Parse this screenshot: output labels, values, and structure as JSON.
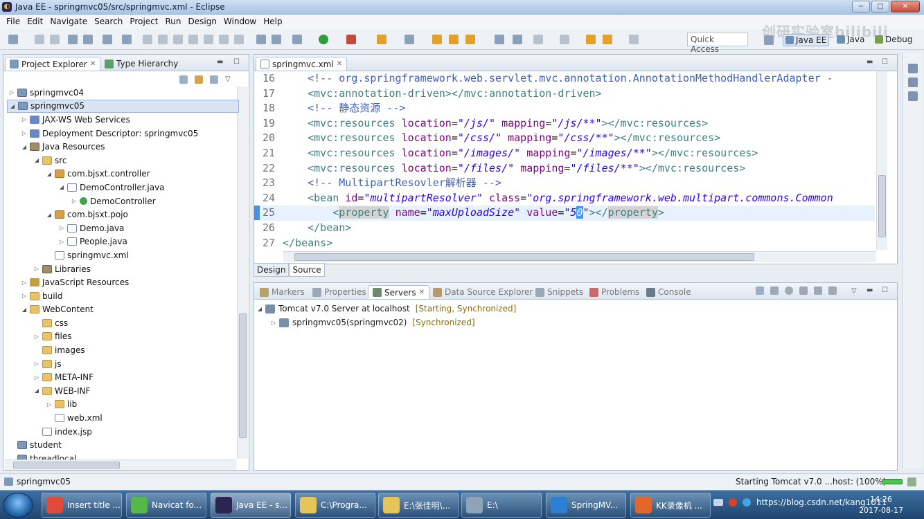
{
  "window": {
    "title": "Java EE - springmvc05/src/springmvc.xml - Eclipse",
    "buttons": [
      "−",
      "□",
      "✕"
    ]
  },
  "menu": [
    "File",
    "Edit",
    "Navigate",
    "Search",
    "Project",
    "Run",
    "Design",
    "Window",
    "Help"
  ],
  "toolbar": {
    "quick_access": "Quick Access",
    "perspectives": [
      "Java EE",
      "Java",
      "Debug"
    ]
  },
  "watermark": "创研实验室bilibili",
  "explorer": {
    "tabs": [
      {
        "label": "Project Explorer",
        "active": true
      },
      {
        "label": "Type Hierarchy",
        "active": false
      }
    ],
    "tree": [
      {
        "label": "springmvc04",
        "indent": 0,
        "arrow": "▷",
        "icon": "proj"
      },
      {
        "label": "springmvc05",
        "indent": 0,
        "arrow": "◢",
        "icon": "proj",
        "selected": true
      },
      {
        "label": "JAX-WS Web Services",
        "indent": 1,
        "arrow": "▷",
        "icon": "ws"
      },
      {
        "label": "Deployment Descriptor: springmvc05",
        "indent": 1,
        "arrow": "▷",
        "icon": "ws"
      },
      {
        "label": "Java Resources",
        "indent": 1,
        "arrow": "◢",
        "icon": "lib"
      },
      {
        "label": "src",
        "indent": 2,
        "arrow": "◢",
        "icon": "folder"
      },
      {
        "label": "com.bjsxt.controller",
        "indent": 3,
        "arrow": "◢",
        "icon": "pkg"
      },
      {
        "label": "DemoController.java",
        "indent": 4,
        "arrow": "◢",
        "icon": "java"
      },
      {
        "label": "DemoController",
        "indent": 5,
        "arrow": "▷",
        "icon": "cls"
      },
      {
        "label": "com.bjsxt.pojo",
        "indent": 3,
        "arrow": "◢",
        "icon": "pkg"
      },
      {
        "label": "Demo.java",
        "indent": 4,
        "arrow": "▷",
        "icon": "java"
      },
      {
        "label": "People.java",
        "indent": 4,
        "arrow": "▷",
        "icon": "java"
      },
      {
        "label": "springmvc.xml",
        "indent": 3,
        "arrow": "",
        "icon": "xml"
      },
      {
        "label": "Libraries",
        "indent": 2,
        "arrow": "▷",
        "icon": "lib"
      },
      {
        "label": "JavaScript Resources",
        "indent": 1,
        "arrow": "▷",
        "icon": "jsres"
      },
      {
        "label": "build",
        "indent": 1,
        "arrow": "▷",
        "icon": "folder"
      },
      {
        "label": "WebContent",
        "indent": 1,
        "arrow": "◢",
        "icon": "folder"
      },
      {
        "label": "css",
        "indent": 2,
        "arrow": "",
        "icon": "folder"
      },
      {
        "label": "files",
        "indent": 2,
        "arrow": "▷",
        "icon": "folder"
      },
      {
        "label": "images",
        "indent": 2,
        "arrow": "",
        "icon": "folder"
      },
      {
        "label": "js",
        "indent": 2,
        "arrow": "▷",
        "icon": "folder"
      },
      {
        "label": "META-INF",
        "indent": 2,
        "arrow": "▷",
        "icon": "folder"
      },
      {
        "label": "WEB-INF",
        "indent": 2,
        "arrow": "◢",
        "icon": "folder"
      },
      {
        "label": "lib",
        "indent": 3,
        "arrow": "▷",
        "icon": "folder"
      },
      {
        "label": "web.xml",
        "indent": 3,
        "arrow": "",
        "icon": "xml"
      },
      {
        "label": "index.jsp",
        "indent": 2,
        "arrow": "",
        "icon": "xml"
      },
      {
        "label": "student",
        "indent": 0,
        "arrow": "",
        "icon": "proj"
      },
      {
        "label": "threadlocal",
        "indent": 0,
        "arrow": "",
        "icon": "proj"
      }
    ]
  },
  "editor": {
    "tab": "springmvc.xml",
    "current_line": 25,
    "lines": [
      {
        "num": "16",
        "parts": [
          [
            "c-com",
            "    <!-- org.springframework.web.servlet.mvc.annotation.AnnotationMethodHandlerAdapter -"
          ]
        ]
      },
      {
        "num": "17",
        "parts": [
          [
            "c-tag",
            "    <mvc:annotation-driven></mvc:annotation-driven>"
          ]
        ]
      },
      {
        "num": "18",
        "parts": [
          [
            "c-com",
            "    <!-- 静态资源 -->"
          ]
        ]
      },
      {
        "num": "19",
        "parts": [
          [
            "c-tag",
            "    <mvc:resources "
          ],
          [
            "c-attr",
            "location"
          ],
          [
            "c-txt",
            "="
          ],
          [
            "c-val",
            "\"/js/\""
          ],
          [
            "c-txt",
            " "
          ],
          [
            "c-attr",
            "mapping"
          ],
          [
            "c-txt",
            "="
          ],
          [
            "c-val",
            "\"/js/**\""
          ],
          [
            "c-tag",
            "></mvc:resources>"
          ]
        ]
      },
      {
        "num": "20",
        "parts": [
          [
            "c-tag",
            "    <mvc:resources "
          ],
          [
            "c-attr",
            "location"
          ],
          [
            "c-txt",
            "="
          ],
          [
            "c-val",
            "\"/css/\""
          ],
          [
            "c-txt",
            " "
          ],
          [
            "c-attr",
            "mapping"
          ],
          [
            "c-txt",
            "="
          ],
          [
            "c-val",
            "\"/css/**\""
          ],
          [
            "c-tag",
            "></mvc:resources>"
          ]
        ]
      },
      {
        "num": "21",
        "parts": [
          [
            "c-tag",
            "    <mvc:resources "
          ],
          [
            "c-attr",
            "location"
          ],
          [
            "c-txt",
            "="
          ],
          [
            "c-val",
            "\"/images/\""
          ],
          [
            "c-txt",
            " "
          ],
          [
            "c-attr",
            "mapping"
          ],
          [
            "c-txt",
            "="
          ],
          [
            "c-val",
            "\"/images/**\""
          ],
          [
            "c-tag",
            "></mvc:resources>"
          ]
        ]
      },
      {
        "num": "22",
        "parts": [
          [
            "c-tag",
            "    <mvc:resources "
          ],
          [
            "c-attr",
            "location"
          ],
          [
            "c-txt",
            "="
          ],
          [
            "c-val",
            "\"/files/\""
          ],
          [
            "c-txt",
            " "
          ],
          [
            "c-attr",
            "mapping"
          ],
          [
            "c-txt",
            "="
          ],
          [
            "c-val",
            "\"/files/**\""
          ],
          [
            "c-tag",
            "></mvc:resources>"
          ]
        ]
      },
      {
        "num": "23",
        "parts": [
          [
            "c-com",
            "    <!-- MultipartResovler解析器 -->"
          ]
        ]
      },
      {
        "num": "24",
        "parts": [
          [
            "c-tag",
            "    <bean "
          ],
          [
            "c-attr",
            "id"
          ],
          [
            "c-txt",
            "="
          ],
          [
            "c-val",
            "\"multipartResolver\""
          ],
          [
            "c-txt",
            " "
          ],
          [
            "c-attr",
            "class"
          ],
          [
            "c-txt",
            "="
          ],
          [
            "c-val",
            "\"org.springframework.web.multipart.commons.Common"
          ]
        ]
      },
      {
        "num": "25",
        "parts": [
          [
            "c-tag",
            "        <"
          ],
          [
            "c-tag hl",
            "property"
          ],
          [
            "c-txt",
            " "
          ],
          [
            "c-attr",
            "name"
          ],
          [
            "c-txt",
            "="
          ],
          [
            "c-val",
            "\"maxUploadSize\""
          ],
          [
            "c-txt",
            " "
          ],
          [
            "c-attr",
            "value"
          ],
          [
            "c-txt",
            "="
          ],
          [
            "c-val",
            "\"5"
          ],
          [
            "c-val caret",
            "0"
          ],
          [
            "c-val",
            "\""
          ],
          [
            "c-tag",
            "></"
          ],
          [
            "c-tag hl",
            "property"
          ],
          [
            "c-tag",
            ">"
          ]
        ]
      },
      {
        "num": "26",
        "parts": [
          [
            "c-tag",
            "    </bean>"
          ]
        ]
      },
      {
        "num": "27",
        "parts": [
          [
            "c-tag",
            "</beans>"
          ]
        ]
      }
    ],
    "bottom_tabs": [
      "Design",
      "Source"
    ]
  },
  "console": {
    "tabs": [
      {
        "label": "Markers",
        "active": false
      },
      {
        "label": "Properties",
        "active": false
      },
      {
        "label": "Servers",
        "active": true
      },
      {
        "label": "Data Source Explorer",
        "active": false
      },
      {
        "label": "Snippets",
        "active": false
      },
      {
        "label": "Problems",
        "active": false
      },
      {
        "label": "Console",
        "active": false
      }
    ],
    "servers": [
      {
        "label": "Tomcat v7.0 Server at localhost",
        "status": "[Starting, Synchronized]",
        "arrow": "◢",
        "indent": 0
      },
      {
        "label": "springmvc05(springmvc02)",
        "status": "[Synchronized]",
        "arrow": "▷",
        "indent": 1
      }
    ]
  },
  "statusbar": {
    "left": "springmvc05",
    "right": "Starting Tomcat v7.0 ...host: (100%)",
    "progress": 1.0
  },
  "taskbar": {
    "items": [
      {
        "label": "Insert title ...",
        "color": "#e04a3a",
        "active": false
      },
      {
        "label": "Navicat fo...",
        "color": "#55b847",
        "active": false
      },
      {
        "label": "Java EE - s...",
        "color": "#2c2552",
        "active": true
      },
      {
        "label": "C:\\Progra...",
        "color": "#e5c45a",
        "active": false
      },
      {
        "label": "E:\\张佳明\\...",
        "color": "#e5c45a",
        "active": false
      },
      {
        "label": "E:\\",
        "color": "#8ea3b6",
        "active": false
      },
      {
        "label": "SpringMV...",
        "color": "#2b7fd4",
        "active": false
      },
      {
        "label": "KK录像机 ...",
        "color": "#e3652a",
        "active": false
      }
    ],
    "tray_text": "https://blog.csdn.net/kang1011",
    "time": "14:26",
    "date": "2017-08-17"
  }
}
